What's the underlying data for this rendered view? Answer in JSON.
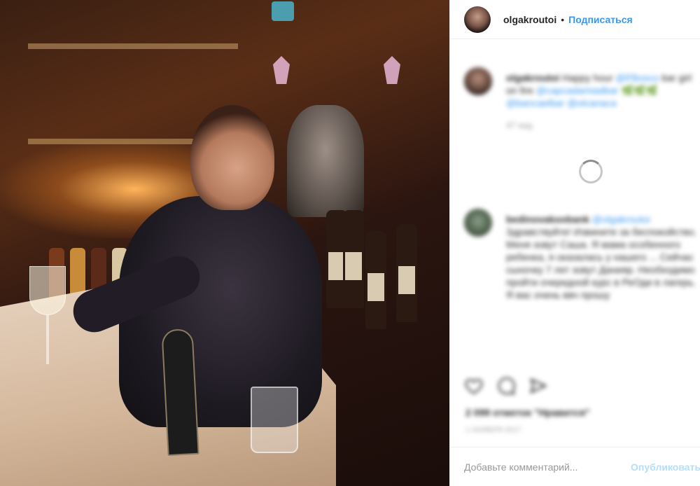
{
  "post": {
    "username": "olgakroutoi",
    "separator": "•",
    "follow_label": "Подписаться"
  },
  "comments": [
    {
      "username": "olgakroutoi",
      "text_a": "Happy hour",
      "mention_a": "@ll'Bosco",
      "text_b": "bar girl on fire",
      "mention_b": "@capcadamiadbar",
      "text_c": "🌿🌿🌿",
      "mention_c": "@bancaelbar",
      "mention_d": "@olcanaca",
      "time": "47 нед."
    },
    {
      "username": "bedinovakoobank",
      "mention": "@olgakroutoi",
      "text": "Здравствуйте! Извините за беспокойство. Меня зовут Саша. Я мама особенного ребенка, я оказалась у нашего ... Сейчас сыночку 7 лет зовут Данияр. Необходимо пройти очередной курс в РеОди в лагерь. Я вас очень ввч прошу"
    }
  ],
  "footer": {
    "likes_text": "2 099 отметок \"Нравится\"",
    "time_text": "1 НОЯБРЯ 2017",
    "comment_placeholder": "Добавьте комментарий...",
    "publish_label": "Опубликовать"
  },
  "icons": {
    "like": "heart-icon",
    "comment": "comment-icon",
    "share": "share-icon"
  },
  "colors": {
    "link": "#3897f0",
    "publish_disabled": "#b2dffc",
    "muted": "#999999"
  }
}
